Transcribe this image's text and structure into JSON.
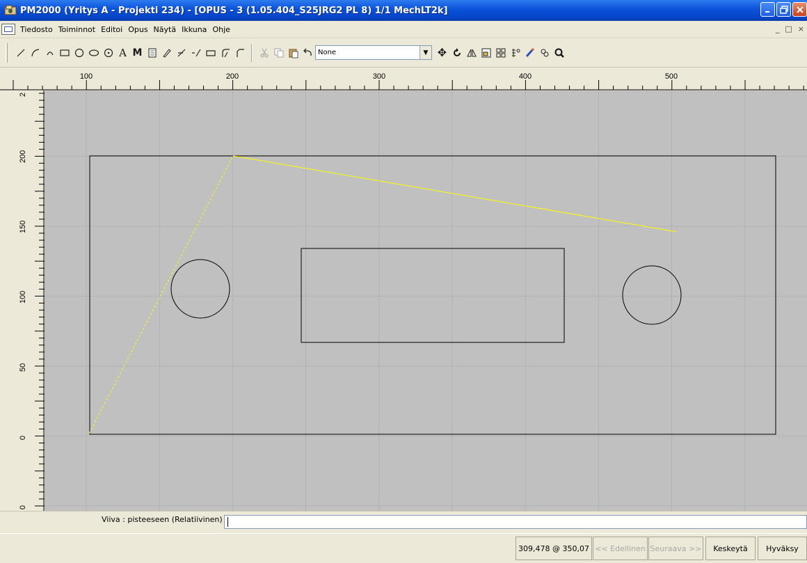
{
  "window": {
    "title": "PM2000 (Yritys A - Projekti 234) - [OPUS - 3 (1.05.404_S25JRG2 PL 8) 1/1  MechLT2k]",
    "app_icon": "pm2000-app-icon",
    "controls": [
      "minimize",
      "maximize",
      "close"
    ]
  },
  "menu": {
    "items": [
      "Tiedosto",
      "Toiminnot",
      "Editoi",
      "Opus",
      "Näytä",
      "Ikkuna",
      "Ohje"
    ]
  },
  "toolbar": {
    "draw_tools": [
      "line-icon",
      "arc-icon",
      "arc2-icon",
      "rectangle-icon",
      "circle-icon",
      "ellipse-icon",
      "point-circle-icon",
      "text-icon",
      "measure-icon",
      "hatch-icon",
      "pen-icon",
      "trim-icon",
      "extend-icon",
      "rect2-icon",
      "fillet-icon",
      "chamfer-icon"
    ],
    "edit_tools": [
      "cut-icon",
      "copy-icon",
      "paste-icon",
      "undo-icon"
    ],
    "layer_select_value": "None",
    "transform_tools": [
      "move-icon",
      "rotate-icon",
      "mirror-icon",
      "scale-icon",
      "array-icon",
      "snap-icon",
      "properties-icon",
      "group-icon",
      "zoom-icon"
    ]
  },
  "rulers": {
    "horizontal_labels": [
      "100",
      "200",
      "300",
      "400",
      "500"
    ],
    "vertical_labels": [
      "2",
      "200",
      "150",
      "100",
      "50",
      "0",
      "0"
    ]
  },
  "command": {
    "prompt": "Viiva : pisteeseen (Relatiivinen)",
    "input_value": ""
  },
  "status": {
    "coords": "309,478 @ 350,07",
    "prev_button": "<< Edellinen",
    "next_button": "Seuraava >>",
    "cancel_button": "Keskeytä",
    "accept_button": "Hyväksy"
  },
  "colors": {
    "canvas_bg": "#c0c0c0",
    "grid": "#a8a8a8",
    "geometry": "#000000",
    "rubberband": "#ffff00",
    "titlebar": "#0a52d8"
  }
}
